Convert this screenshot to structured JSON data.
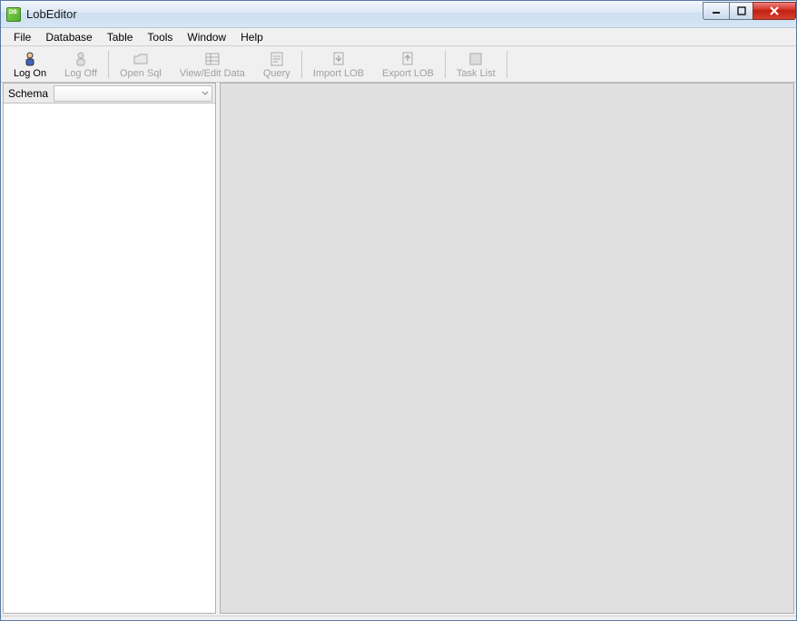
{
  "window": {
    "title": "LobEditor"
  },
  "menu": {
    "items": [
      "File",
      "Database",
      "Table",
      "Tools",
      "Window",
      "Help"
    ]
  },
  "toolbar": {
    "logon": {
      "label": "Log On",
      "enabled": true
    },
    "logoff": {
      "label": "Log Off",
      "enabled": false
    },
    "opensql": {
      "label": "Open Sql",
      "enabled": false
    },
    "viewedit": {
      "label": "View/Edit Data",
      "enabled": false
    },
    "query": {
      "label": "Query",
      "enabled": false
    },
    "importlob": {
      "label": "Import LOB",
      "enabled": false
    },
    "exportlob": {
      "label": "Export LOB",
      "enabled": false
    },
    "tasklist": {
      "label": "Task List",
      "enabled": false
    }
  },
  "sidebar": {
    "schema_label": "Schema",
    "schema_value": ""
  }
}
